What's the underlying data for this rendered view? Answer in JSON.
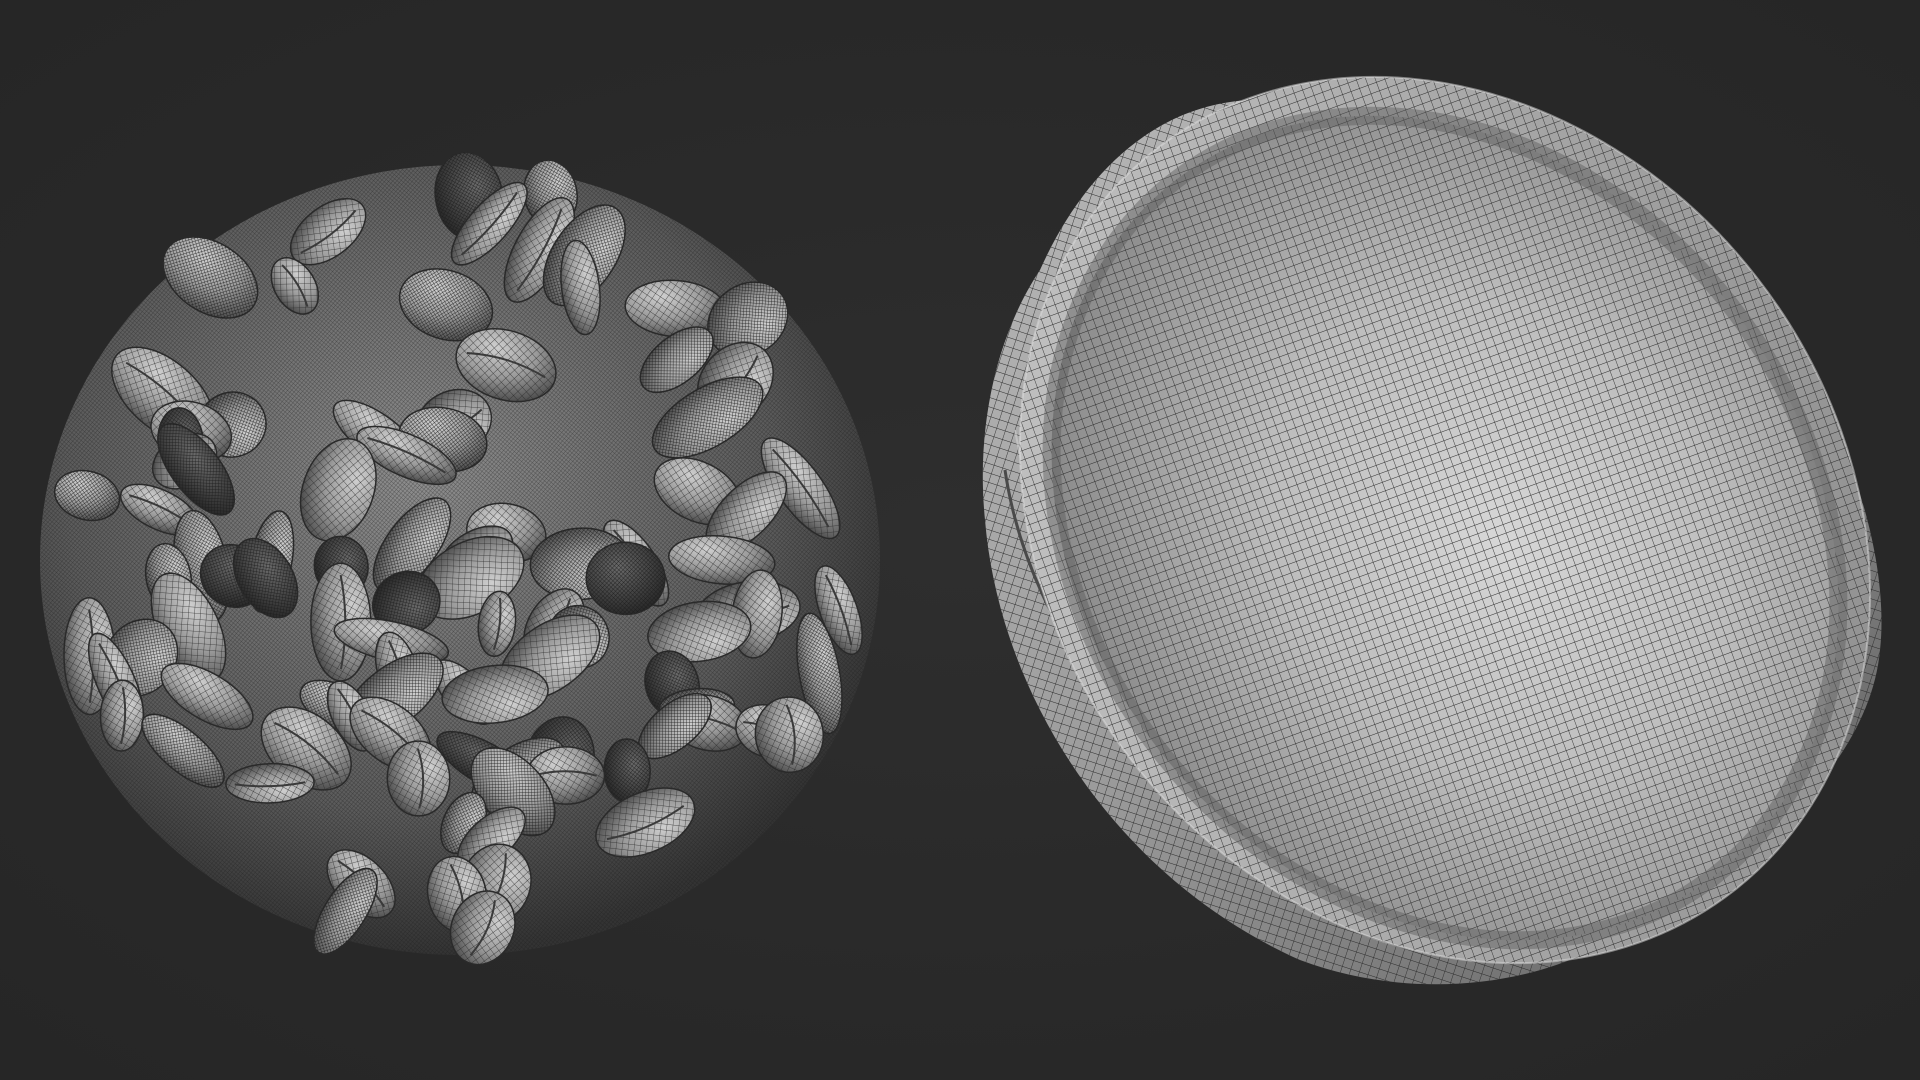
{
  "scene": {
    "background_color": "#2a2a2a",
    "wire_color": "#2b2b2b",
    "surface_light": "#d8d8d8",
    "surface_mid": "#9a9a9a",
    "surface_dark": "#555555",
    "objects": [
      "nut-cluster",
      "bowl"
    ]
  }
}
